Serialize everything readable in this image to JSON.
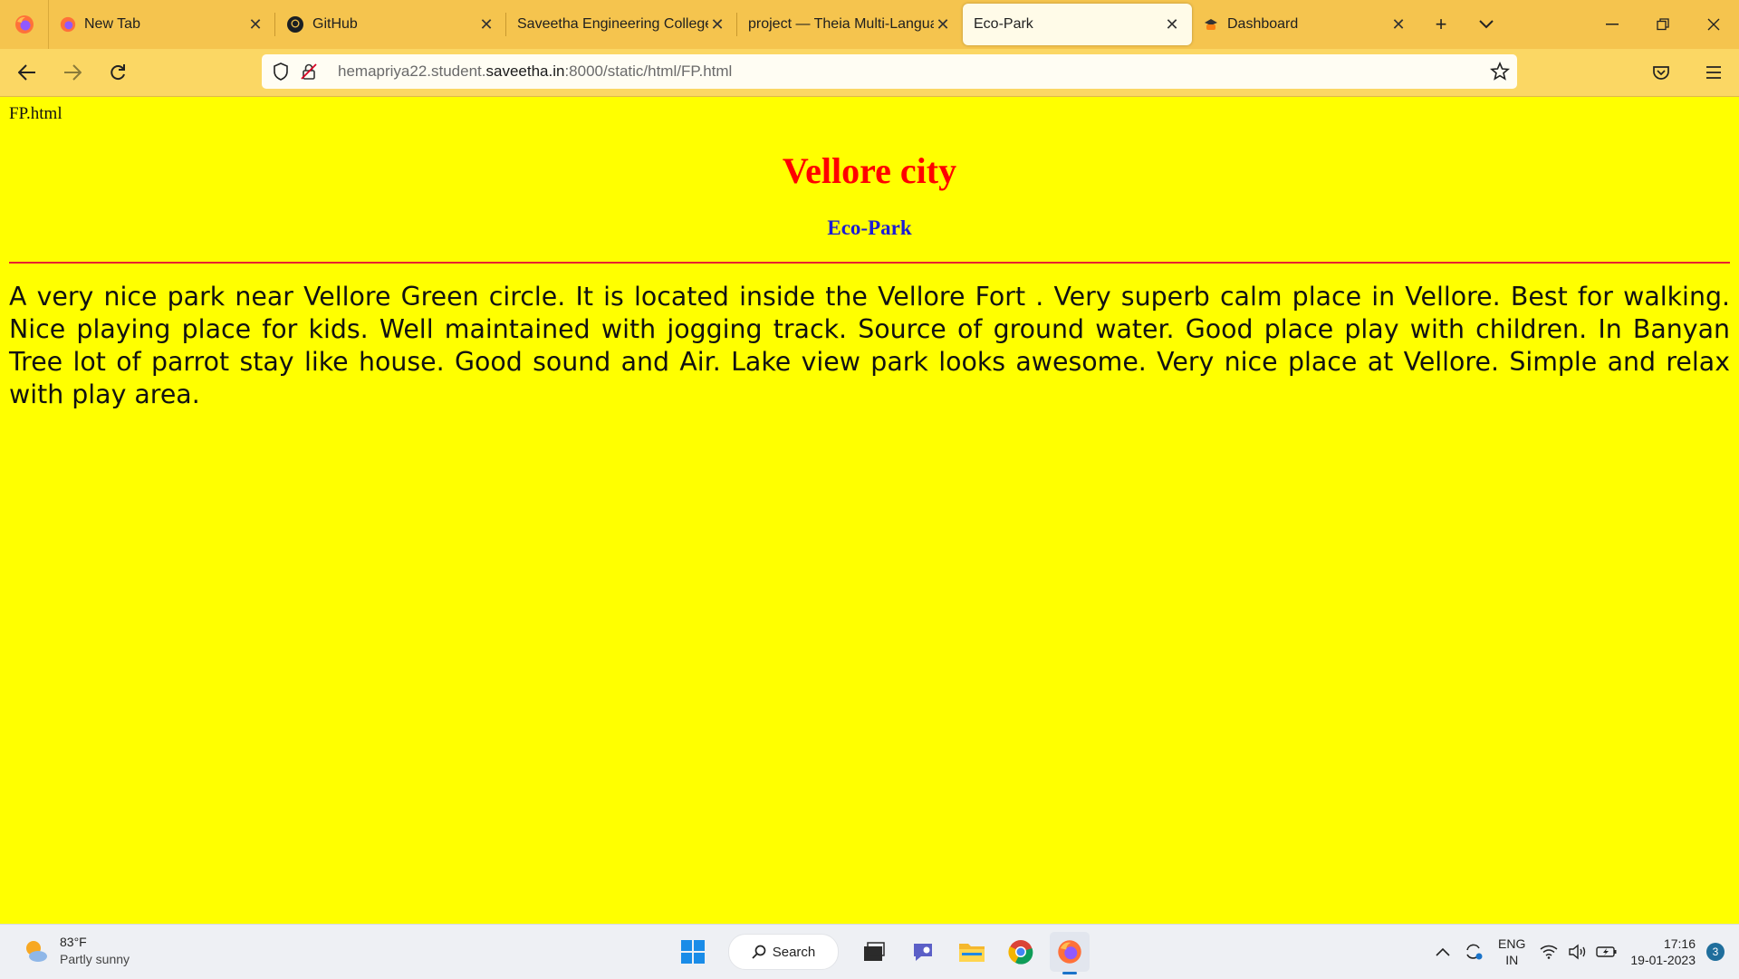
{
  "browser": {
    "tabs": [
      {
        "label": "New Tab",
        "icon": "firefox-icon"
      },
      {
        "label": "GitHub",
        "icon": "github-icon"
      },
      {
        "label": "Saveetha Engineering College",
        "icon": "none"
      },
      {
        "label": "project — Theia Multi-Language",
        "icon": "none"
      },
      {
        "label": "Eco-Park",
        "icon": "none",
        "active": true
      },
      {
        "label": "Dashboard",
        "icon": "moodle-icon"
      }
    ],
    "url": {
      "prefix": "hemapriya22.student.",
      "host": "saveetha.in",
      "path": ":8000/static/html/FP.html"
    }
  },
  "page": {
    "file_title": "FP.html",
    "heading": "Vellore city",
    "subheading": "Eco-Park",
    "paragraph": "A very nice park near Vellore Green circle. It is located inside the Vellore Fort . Very superb calm place in Vellore. Best for walking. Nice playing place for kids. Well maintained with jogging track. Source of ground water. Good place play with children. In Banyan Tree lot of parrot stay like house. Good sound and Air. Lake view park looks awesome. Very nice place at Vellore. Simple and relax with play area.",
    "colors": {
      "background": "#ffff00",
      "heading": "#ff0000",
      "subheading": "#1b1bd6",
      "rule": "#e8232f"
    }
  },
  "taskbar": {
    "weather_temp": "83°F",
    "weather_cond": "Partly sunny",
    "search_label": "Search",
    "lang_line1": "ENG",
    "lang_line2": "IN",
    "time": "17:16",
    "date": "19-01-2023",
    "notifications": "3"
  }
}
